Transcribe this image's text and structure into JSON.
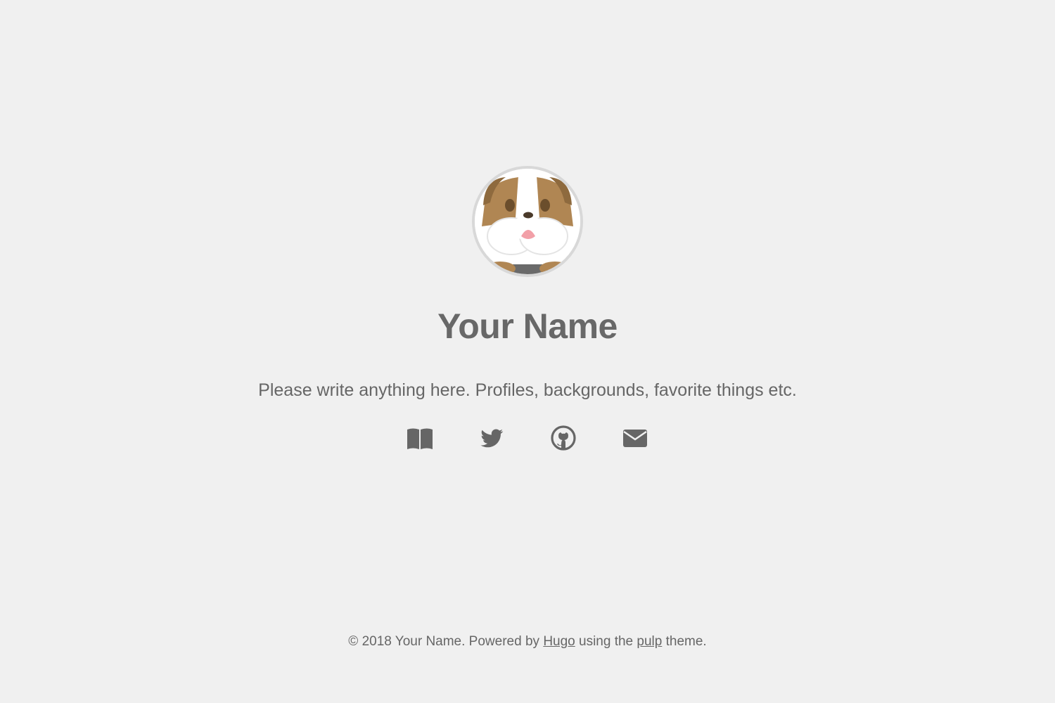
{
  "profile": {
    "avatar_alt": "bulldog avatar",
    "name": "Your Name",
    "bio": "Please write anything here. Profiles, backgrounds, favorite things etc."
  },
  "social": [
    {
      "icon": "book-icon",
      "label": "Blog"
    },
    {
      "icon": "twitter-icon",
      "label": "Twitter"
    },
    {
      "icon": "github-icon",
      "label": "GitHub"
    },
    {
      "icon": "mail-icon",
      "label": "Email"
    }
  ],
  "footer": {
    "prefix": "© 2018 Your Name. Powered by ",
    "hugo_link": "Hugo",
    "middle": " using the ",
    "theme_link": "pulp",
    "suffix": " theme."
  },
  "colors": {
    "background": "#f0f0f0",
    "text": "#666666",
    "avatar_border": "#d8d8d8",
    "dog_brown": "#b08653",
    "dog_tongue": "#f2a0a8"
  }
}
